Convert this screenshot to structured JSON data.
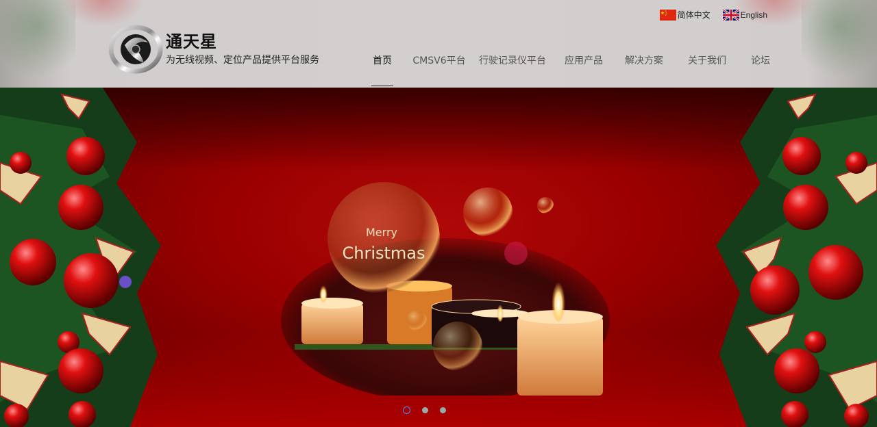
{
  "header": {
    "languages": [
      {
        "label": "简体中文",
        "flag": "cn-flag-icon"
      },
      {
        "label": "English",
        "flag": "uk-flag-icon"
      }
    ],
    "brand": {
      "name": "通天星",
      "slogan": "为无线视频、定位产品提供平台服务"
    },
    "nav": [
      {
        "label": "首页",
        "active": true
      },
      {
        "label": "CMSV6平台",
        "active": false
      },
      {
        "label": "行驶记录仪平台",
        "active": false
      },
      {
        "label": "应用产品",
        "active": false
      },
      {
        "label": "解决方案",
        "active": false
      },
      {
        "label": "关于我们",
        "active": false
      },
      {
        "label": "论坛",
        "active": false
      }
    ]
  },
  "banner": {
    "headline_small": "Merry",
    "headline_large": "Christmas",
    "slides": {
      "count": 3,
      "active_index": 0
    }
  },
  "colors": {
    "banner_red": "#9a0000",
    "dot_active": "#4f8cff",
    "dot_inactive": "#99aaaa"
  }
}
